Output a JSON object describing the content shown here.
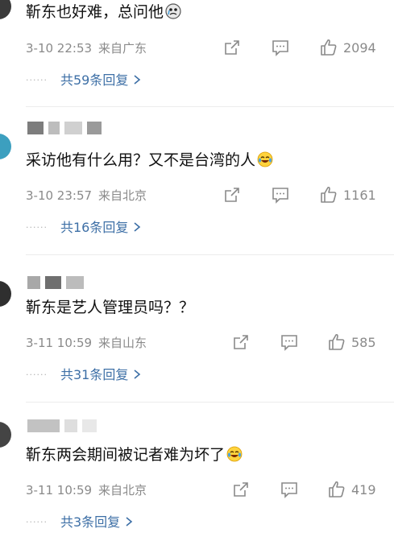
{
  "comments": [
    {
      "text": "靳东也好难，总问他",
      "time": "3-10 22:53",
      "location": "来自广东",
      "likes": "2094",
      "replies": "共59条回复"
    },
    {
      "text": "采访他有什么用？又不是台湾的人",
      "time": "3-10 23:57",
      "location": "来自北京",
      "likes": "1161",
      "replies": "共16条回复"
    },
    {
      "text": "靳东是艺人管理员吗？？",
      "time": "3-11 10:59",
      "location": "来自山东",
      "likes": "585",
      "replies": "共31条回复"
    },
    {
      "text": "靳东两会期间被记者难为坏了",
      "time": "3-11 10:59",
      "location": "来自北京",
      "likes": "419",
      "replies": "共3条回复"
    }
  ],
  "icons": {
    "share": "share-icon",
    "comment": "comment-icon",
    "like": "thumbs-up-icon",
    "emoji_1": "crying-face-emoji",
    "emoji_2": "laughing-tears-emoji"
  },
  "colors": {
    "reply_link": "#3d6fa6",
    "meta_text": "#8a8a8a",
    "divider": "#ececec"
  }
}
